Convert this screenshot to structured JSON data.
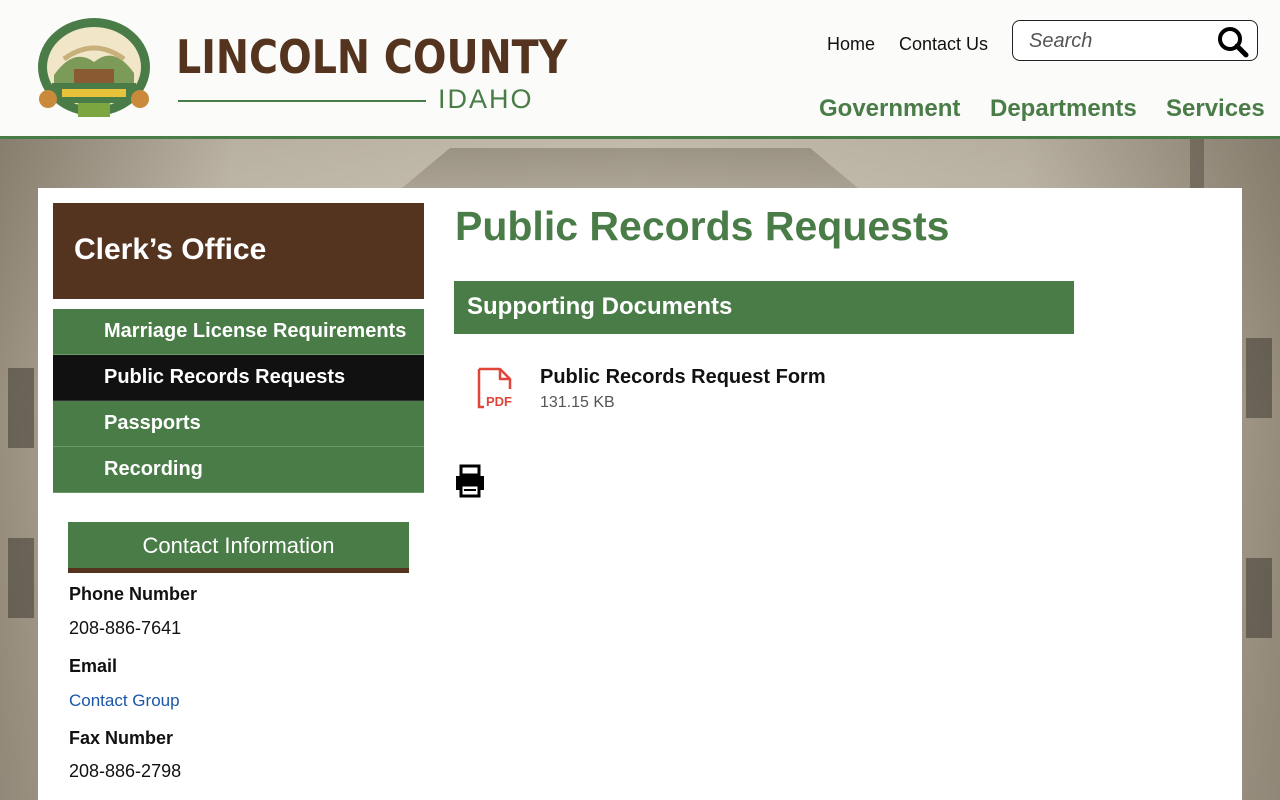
{
  "header": {
    "logo_title": "LINCOLN COUNTY",
    "logo_subtitle": "IDAHO",
    "utility_links": [
      "Home",
      "Contact Us"
    ],
    "search_placeholder": "Search",
    "main_nav": [
      "Government",
      "Departments",
      "Services"
    ]
  },
  "sidebar": {
    "title": "Clerk’s Office",
    "items": [
      {
        "label": "Marriage License Requirements",
        "active": false
      },
      {
        "label": "Public Records Requests",
        "active": true
      },
      {
        "label": "Passports",
        "active": false
      },
      {
        "label": "Recording",
        "active": false
      }
    ]
  },
  "contact": {
    "heading": "Contact Information",
    "phone_label": "Phone Number",
    "phone": "208-886-7641",
    "email_label": "Email",
    "email_link": "Contact Group",
    "fax_label": "Fax Number",
    "fax": "208-886-2798"
  },
  "main": {
    "title": "Public Records Requests",
    "documents_heading": "Supporting Documents",
    "document": {
      "name": "Public Records Request Form",
      "size": "131.15 KB",
      "icon": "pdf-icon"
    }
  },
  "colors": {
    "green": "#4a7c48",
    "brown": "#55341f",
    "active": "#111111",
    "link": "#1a56a8"
  }
}
